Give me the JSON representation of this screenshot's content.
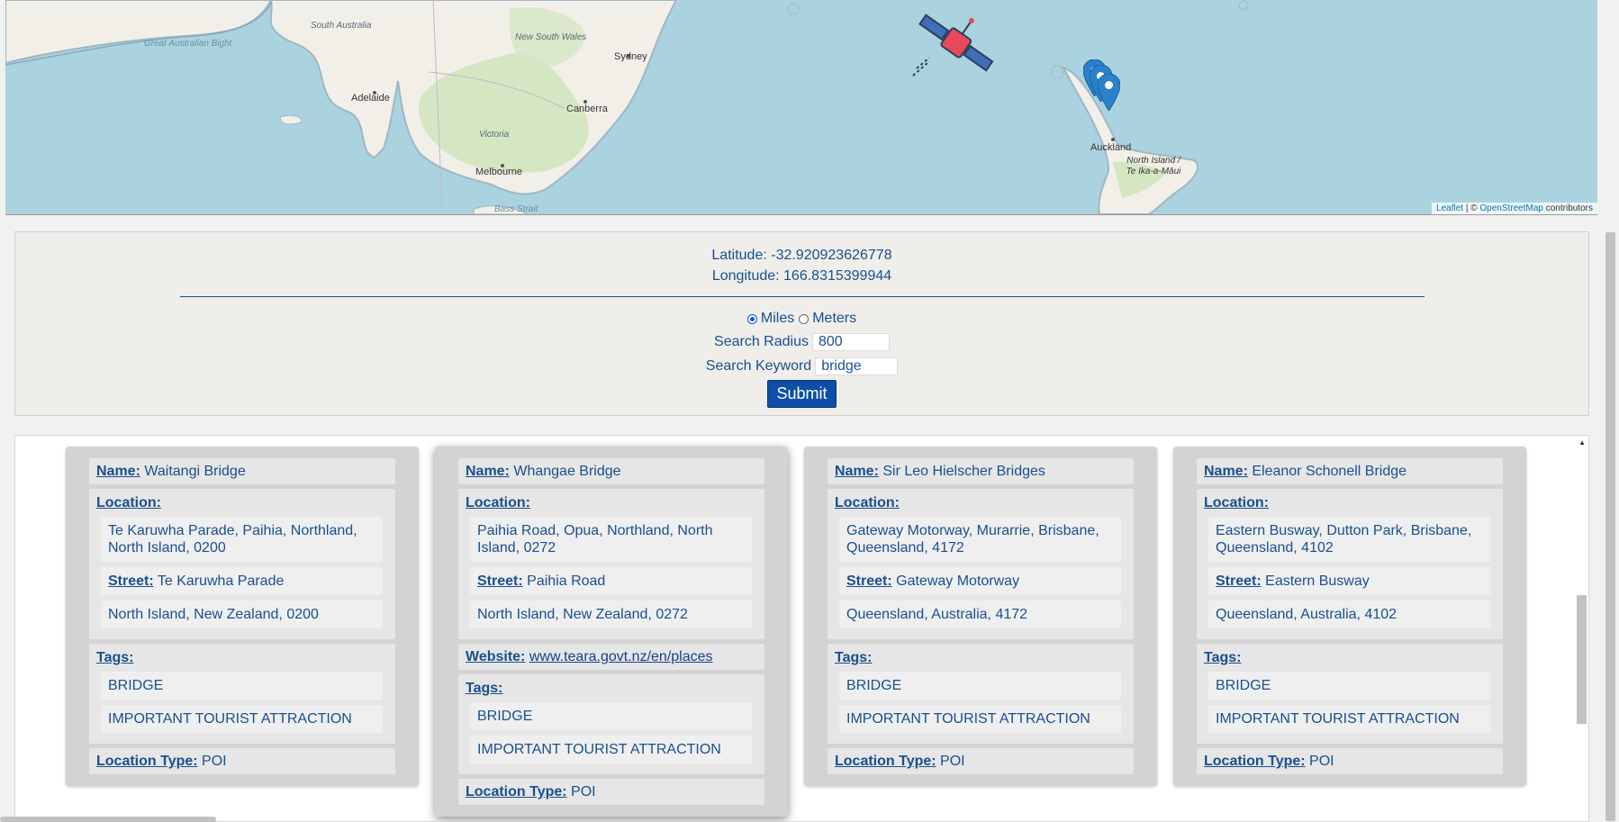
{
  "map": {
    "labels": {
      "south_australia": "South Australia",
      "great_australian_bight": "Great Australian Bight",
      "new_south_wales": "New South Wales",
      "sydney": "Sydney",
      "adelaide": "Adelaide",
      "canberra": "Canberra",
      "victoria": "Victoria",
      "melbourne": "Melbourne",
      "bass_strait": "Bass Strait",
      "auckland": "Auckland",
      "north_island": "North Island / Te Ika-a-Māui"
    },
    "attribution": {
      "leaflet": "Leaflet",
      "separator": " | © ",
      "osm": "OpenStreetMap",
      "contributors": " contributors"
    },
    "icons": [
      "satellite-icon",
      "map-marker-icon"
    ],
    "colors": {
      "water": "#aad3df",
      "land": "#f2efe9",
      "marker": "#2a81cb"
    }
  },
  "form": {
    "latitude": "Latitude: -32.920923626778",
    "longitude": "Longitude: 166.8315399944",
    "unit_miles": "Miles",
    "unit_meters": "Meters",
    "radius_label": "Search Radius",
    "radius_value": "800",
    "keyword_label": "Search Keyword",
    "keyword_value": "bridge",
    "submit_label": "Submit"
  },
  "results": [
    {
      "name_key": "Name:",
      "name": "Waitangi Bridge",
      "location_key": "Location:",
      "address": "Te Karuwha Parade, Paihia, Northland, North Island, 0200",
      "street_key": "Street:",
      "street": "Te Karuwha Parade",
      "region": "North Island, New Zealand, 0200",
      "tags_key": "Tags:",
      "tags": [
        "BRIDGE",
        "IMPORTANT TOURIST ATTRACTION"
      ],
      "type_key": "Location Type:",
      "type": "POI"
    },
    {
      "name_key": "Name:",
      "name": "Whangae Bridge",
      "location_key": "Location:",
      "address": "Paihia Road, Opua, Northland, North Island, 0272",
      "street_key": "Street:",
      "street": "Paihia Road",
      "region": "North Island, New Zealand, 0272",
      "website_key": "Website:",
      "website": "www.teara.govt.nz/en/places",
      "tags_key": "Tags:",
      "tags": [
        "BRIDGE",
        "IMPORTANT TOURIST ATTRACTION"
      ],
      "type_key": "Location Type:",
      "type": "POI"
    },
    {
      "name_key": "Name:",
      "name": "Sir Leo Hielscher Bridges",
      "location_key": "Location:",
      "address": "Gateway Motorway, Murarrie, Brisbane, Queensland, 4172",
      "street_key": "Street:",
      "street": "Gateway Motorway",
      "region": "Queensland, Australia, 4172",
      "tags_key": "Tags:",
      "tags": [
        "BRIDGE",
        "IMPORTANT TOURIST ATTRACTION"
      ],
      "type_key": "Location Type:",
      "type": "POI"
    },
    {
      "name_key": "Name:",
      "name": "Eleanor Schonell Bridge",
      "location_key": "Location:",
      "address": "Eastern Busway, Dutton Park, Brisbane, Queensland, 4102",
      "street_key": "Street:",
      "street": "Eastern Busway",
      "region": "Queensland, Australia, 4102",
      "tags_key": "Tags:",
      "tags": [
        "BRIDGE",
        "IMPORTANT TOURIST ATTRACTION"
      ],
      "type_key": "Location Type:",
      "type": "POI"
    }
  ]
}
